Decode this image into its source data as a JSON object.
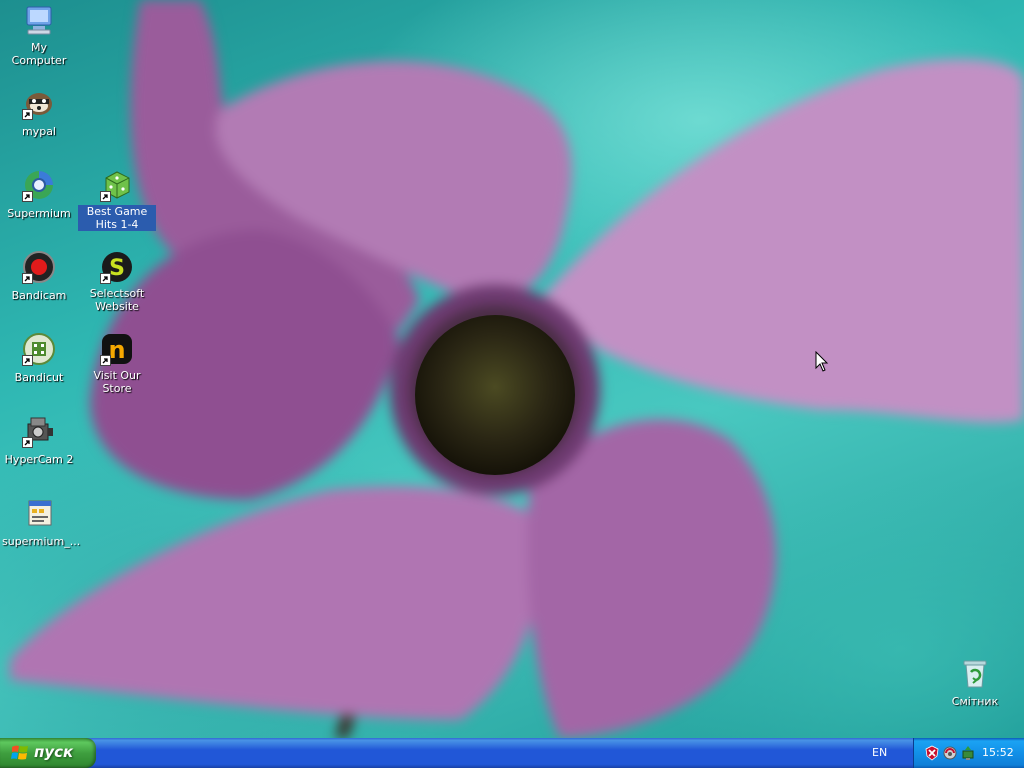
{
  "desktop": {
    "icons": [
      {
        "label": "My Computer",
        "icon": "computer-icon"
      },
      {
        "label": "mypal",
        "icon": "raccoon-icon"
      },
      {
        "label": "Supermium",
        "icon": "browser-globe-icon"
      },
      {
        "label": "Best Game Hits 1-4",
        "icon": "dice-icon"
      },
      {
        "label": "Bandicam",
        "icon": "record-icon"
      },
      {
        "label": "Selectsoft Website",
        "icon": "s-logo-icon"
      },
      {
        "label": "Bandicut",
        "icon": "film-icon"
      },
      {
        "label": "Visit Our Store",
        "icon": "n-logo-icon"
      },
      {
        "label": "HyperCam 2",
        "icon": "camera-icon"
      },
      {
        "label": "supermium_...",
        "icon": "installer-icon"
      },
      {
        "label": "Смітник",
        "icon": "recycle-bin-icon"
      }
    ]
  },
  "taskbar": {
    "start_label": "пуск",
    "language": "EN",
    "clock": "15:52",
    "tray_icons": [
      "security-alert-icon",
      "network-icon",
      "safely-remove-icon"
    ]
  },
  "colors": {
    "taskbar_blue": "#2157d7",
    "start_green": "#3f9f3f",
    "tray_blue": "#1290e8",
    "selection_blue": "#2b5cae"
  }
}
